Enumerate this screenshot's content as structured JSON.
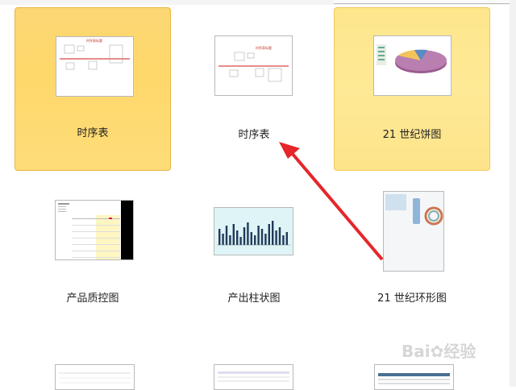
{
  "templates": [
    {
      "label": "时序表",
      "state": "selected",
      "thumb_title": "时序表标题"
    },
    {
      "label": "时序表",
      "state": "normal",
      "thumb_title": "时序表标题"
    },
    {
      "label": "21 世纪饼图",
      "state": "hover"
    },
    {
      "label": "产品质控图",
      "state": "normal"
    },
    {
      "label": "产出柱状图",
      "state": "normal"
    },
    {
      "label": "21 世纪环形图",
      "state": "normal"
    }
  ],
  "watermark": {
    "text": "Bai",
    "suffix": "经验"
  },
  "colors": {
    "selected_bg": "#ffd86b",
    "hover_bg": "#fee996",
    "arrow": "#e5262b"
  }
}
